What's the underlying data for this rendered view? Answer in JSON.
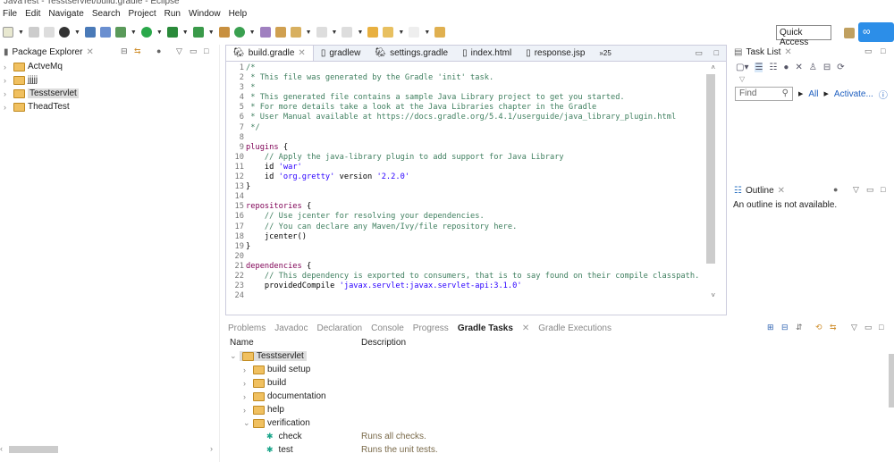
{
  "window_title": "JavaTest - Tesstservlet/build.gradle - Eclipse",
  "menu": [
    "File",
    "Edit",
    "Navigate",
    "Search",
    "Project",
    "Run",
    "Window",
    "Help"
  ],
  "quick_access": "Quick Access",
  "package_explorer": {
    "title": "Package Explorer",
    "items": [
      "ActveMq",
      "jjjjj",
      "Tesstservlet",
      "TheadTest"
    ]
  },
  "editor": {
    "tabs": [
      "build.gradle",
      "gradlew",
      "settings.gradle",
      "index.html",
      "response.jsp",
      "»25"
    ],
    "lines": [
      [
        [
          "cm",
          "/*"
        ]
      ],
      [
        [
          "cm",
          " * This file was generated by the Gradle 'init' task."
        ]
      ],
      [
        [
          "cm",
          " *"
        ]
      ],
      [
        [
          "cm",
          " * This generated file contains a sample Java Library project to get you started."
        ]
      ],
      [
        [
          "cm",
          " * For more details take a look at the Java Libraries chapter in the Gradle"
        ]
      ],
      [
        [
          "cm",
          " * User Manual available at https://docs.gradle.org/5.4.1/userguide/java_library_plugin.html"
        ]
      ],
      [
        [
          "cm",
          " */"
        ]
      ],
      [],
      [
        [
          "kw",
          "plugins"
        ],
        [
          "pl",
          " {"
        ]
      ],
      [
        [
          "cm",
          "    // Apply the java-library plugin to add support for Java Library"
        ]
      ],
      [
        [
          "pl",
          "    id "
        ],
        [
          "str",
          "'war'"
        ]
      ],
      [
        [
          "pl",
          "    id "
        ],
        [
          "str",
          "'org.gretty'"
        ],
        [
          "pl",
          " version "
        ],
        [
          "str",
          "'2.2.0'"
        ]
      ],
      [
        [
          "pl",
          "}"
        ]
      ],
      [],
      [
        [
          "kw",
          "repositories"
        ],
        [
          "pl",
          " {"
        ]
      ],
      [
        [
          "cm",
          "    // Use jcenter for resolving your dependencies."
        ]
      ],
      [
        [
          "cm",
          "    // You can declare any Maven/Ivy/file repository here."
        ]
      ],
      [
        [
          "pl",
          "    jcenter()"
        ]
      ],
      [
        [
          "pl",
          "}"
        ]
      ],
      [],
      [
        [
          "kw",
          "dependencies"
        ],
        [
          "pl",
          " {"
        ]
      ],
      [
        [
          "cm",
          "    // This dependency is exported to consumers, that is to say found on their compile classpath."
        ]
      ],
      [
        [
          "pl",
          "    providedCompile "
        ],
        [
          "str",
          "'javax.servlet:javax.servlet-api:3.1.0'"
        ]
      ],
      []
    ]
  },
  "task_list": {
    "title": "Task List",
    "find_placeholder": "Find",
    "all": "All",
    "activate": "Activate..."
  },
  "outline": {
    "title": "Outline",
    "message": "An outline is not available."
  },
  "bottom": {
    "tabs": [
      "Problems",
      "Javadoc",
      "Declaration",
      "Console",
      "Progress",
      "Gradle Tasks",
      "Gradle Executions"
    ],
    "columns": [
      "Name",
      "Description"
    ],
    "root": "Tesstservlet",
    "groups": [
      "build setup",
      "build",
      "documentation",
      "help",
      "verification"
    ],
    "tasks": [
      {
        "name": "check",
        "desc": "Runs all checks."
      },
      {
        "name": "test",
        "desc": "Runs the unit tests."
      }
    ]
  }
}
